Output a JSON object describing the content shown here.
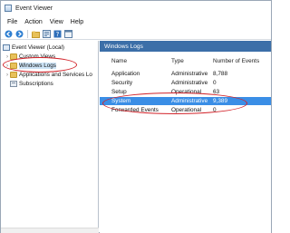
{
  "window": {
    "title": "Event Viewer"
  },
  "menu": [
    {
      "label": "File"
    },
    {
      "label": "Action"
    },
    {
      "label": "View"
    },
    {
      "label": "Help"
    }
  ],
  "toolbar": {
    "buttons": [
      "back-icon",
      "forward-icon",
      "folder-up-icon",
      "properties-icon",
      "help-icon",
      "console-icon"
    ]
  },
  "tree": {
    "root": "Event Viewer (Local)",
    "items": [
      {
        "label": "Custom Views"
      },
      {
        "label": "Windows Logs"
      },
      {
        "label": "Applications and Services Lo"
      },
      {
        "label": "Subscriptions"
      }
    ]
  },
  "panel": {
    "title": "Windows Logs",
    "columns": [
      "Name",
      "Type",
      "Number of Events"
    ],
    "rows": [
      {
        "name": "Application",
        "type": "Administrative",
        "events": "8,788"
      },
      {
        "name": "Security",
        "type": "Administrative",
        "events": "0"
      },
      {
        "name": "Setup",
        "type": "Operational",
        "events": "63"
      },
      {
        "name": "System",
        "type": "Administrative",
        "events": "9,389"
      },
      {
        "name": "Forwarded Events",
        "type": "Operational",
        "events": "0"
      }
    ]
  },
  "colors": {
    "header_bg": "#3c6fa8",
    "selection": "#3a8ee6",
    "annotation": "#d2232a"
  }
}
